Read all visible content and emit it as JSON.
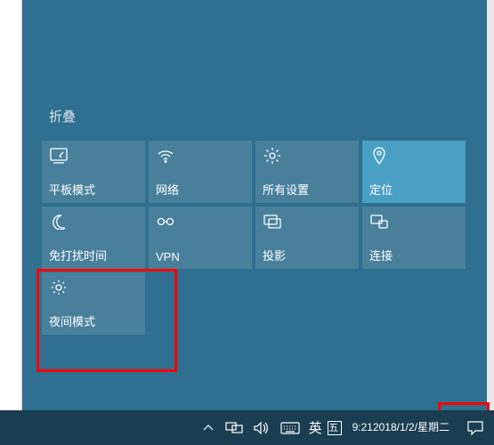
{
  "action_center": {
    "collapse_label": "折叠",
    "tiles": [
      {
        "id": "tablet-mode",
        "label": "平板模式",
        "icon": "tablet-icon",
        "active": false
      },
      {
        "id": "network",
        "label": "网络",
        "icon": "wifi-icon",
        "active": false
      },
      {
        "id": "all-settings",
        "label": "所有设置",
        "icon": "gear-icon",
        "active": false
      },
      {
        "id": "location",
        "label": "定位",
        "icon": "location-icon",
        "active": true
      },
      {
        "id": "quiet-hours",
        "label": "免打扰时间",
        "icon": "moon-icon",
        "active": false
      },
      {
        "id": "vpn",
        "label": "VPN",
        "icon": "vpn-icon",
        "active": false
      },
      {
        "id": "project",
        "label": "投影",
        "icon": "project-icon",
        "active": false
      },
      {
        "id": "connect",
        "label": "连接",
        "icon": "connect-icon",
        "active": false
      },
      {
        "id": "night-light",
        "label": "夜间模式",
        "icon": "sun-icon",
        "active": false
      }
    ]
  },
  "taskbar": {
    "ime_lang": "英",
    "ime_mode": "五",
    "time": "9:21",
    "date": "2018/1/2/星期二"
  },
  "annotations": {
    "night_light_highlight": true,
    "action_center_button_highlight": true
  }
}
